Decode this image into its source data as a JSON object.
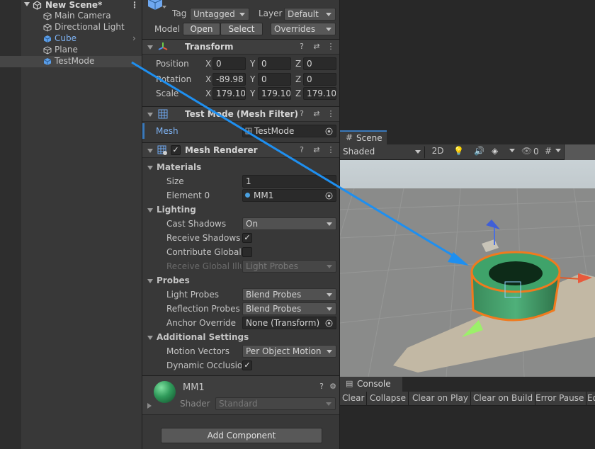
{
  "hierarchy": {
    "scene_name": "New Scene*",
    "items": [
      {
        "label": "Main Camera",
        "color": "#c4c4c4"
      },
      {
        "label": "Directional Light",
        "color": "#c4c4c4"
      },
      {
        "label": "Cube",
        "color": "#7fb4f5"
      },
      {
        "label": "Plane",
        "color": "#c4c4c4"
      },
      {
        "label": "TestMode",
        "color": "#c4c4c4"
      }
    ]
  },
  "inspector": {
    "tag_label": "Tag",
    "tag_value": "Untagged",
    "layer_label": "Layer",
    "layer_value": "Default",
    "model_label": "Model",
    "open_label": "Open",
    "select_label": "Select",
    "overrides_label": "Overrides",
    "transform": {
      "title": "Transform",
      "position_label": "Position",
      "rotation_label": "Rotation",
      "scale_label": "Scale",
      "x": "X",
      "y": "Y",
      "z": "Z",
      "pos": [
        "0",
        "0",
        "0"
      ],
      "rot": [
        "-89.98",
        "0",
        "0"
      ],
      "scale": [
        "179.100",
        "179.100",
        "179.100"
      ]
    },
    "mesh_filter": {
      "title": "Test Mode (Mesh Filter)",
      "mesh_label": "Mesh",
      "mesh_value": "TestMode"
    },
    "mesh_renderer": {
      "title": "Mesh Renderer",
      "materials_label": "Materials",
      "size_label": "Size",
      "size_value": "1",
      "element0_label": "Element 0",
      "element0_value": "MM1",
      "lighting_label": "Lighting",
      "cast_shadows_label": "Cast Shadows",
      "cast_shadows_value": "On",
      "receive_shadows_label": "Receive Shadows",
      "contribute_gi_label": "Contribute Global I",
      "receive_gi_label": "Receive Global Illu",
      "receive_gi_value": "Light Probes",
      "probes_label": "Probes",
      "light_probes_label": "Light Probes",
      "light_probes_value": "Blend Probes",
      "reflection_probes_label": "Reflection Probes",
      "reflection_probes_value": "Blend Probes",
      "anchor_override_label": "Anchor Override",
      "anchor_override_value": "None (Transform)",
      "additional_label": "Additional Settings",
      "motion_vectors_label": "Motion Vectors",
      "motion_vectors_value": "Per Object Motion",
      "dynamic_occlusion_label": "Dynamic Occlusio"
    },
    "material": {
      "name": "MM1",
      "shader_label": "Shader",
      "shader_value": "Standard"
    },
    "add_component_label": "Add Component"
  },
  "scene": {
    "tab_label": "Scene",
    "shading_mode": "Shaded",
    "mode_2d": "2D",
    "hidden_count": "0"
  },
  "console": {
    "tab_label": "Console",
    "buttons": [
      "Clear",
      "Collapse",
      "Clear on Play",
      "Clear on Build",
      "Error Pause",
      "Ed"
    ]
  },
  "colors": {
    "selection": "#3a79bb",
    "arrow": "#1e8ff0",
    "object_outline": "#f07a1e",
    "object_fill": "#3fa36a"
  }
}
